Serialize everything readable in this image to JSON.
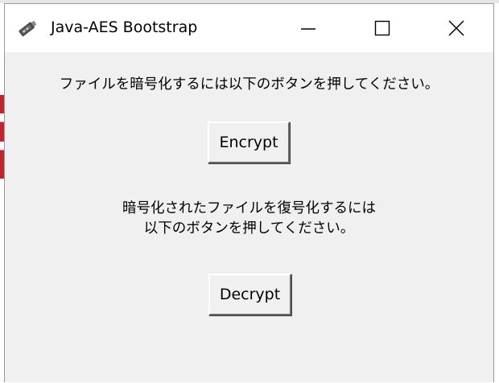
{
  "window": {
    "title": "Java-AES Bootstrap",
    "icon": "java-cup-icon",
    "controls": {
      "minimize_icon": "minimize-icon",
      "maximize_icon": "maximize-icon",
      "close_icon": "close-icon"
    }
  },
  "main": {
    "encrypt_instruction": "ファイルを暗号化するには以下のボタンを押してください。",
    "encrypt_button_label": "Encrypt",
    "decrypt_instruction_line1": "暗号化されたファイルを復号化するには",
    "decrypt_instruction_line2": "以下のボタンを押してください。",
    "decrypt_button_label": "Decrypt"
  },
  "colors": {
    "window_background": "#f0f0f0",
    "titlebar_background": "#ffffff",
    "button_face": "#f0f0f0"
  }
}
